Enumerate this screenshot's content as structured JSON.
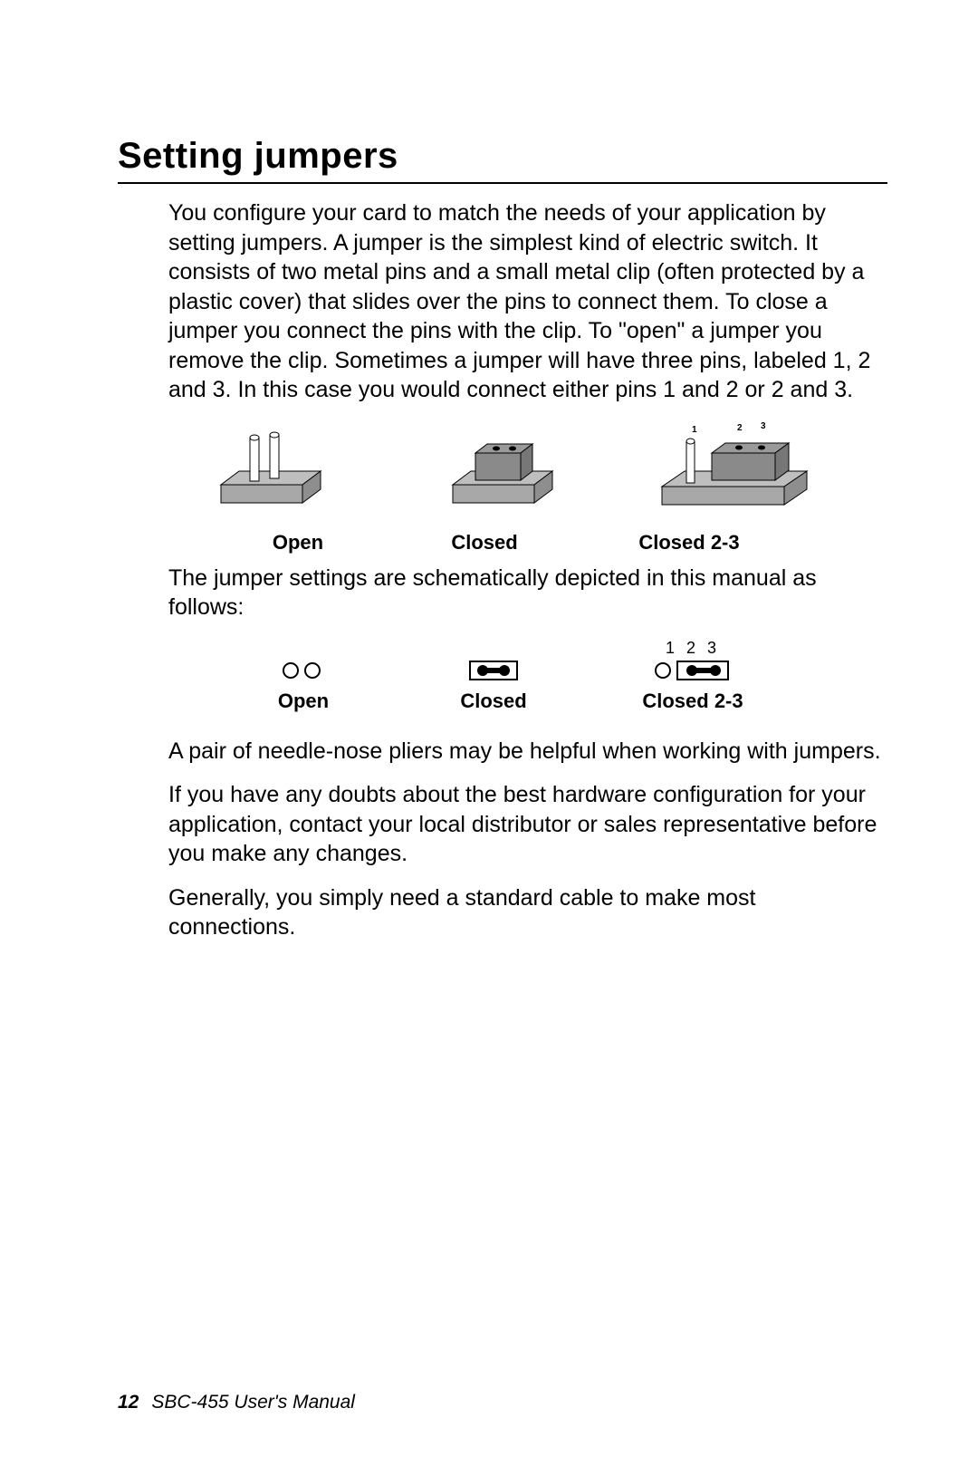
{
  "title": "Setting jumpers",
  "para1": "You configure your card to match the needs of your application by setting jumpers. A jumper is the simplest kind of electric switch. It consists of two metal pins and a small metal clip (often protected by a plastic cover) that slides over the pins to connect them. To close a jumper you connect the pins with the clip. To  \"open\" a jumper you remove the clip. Sometimes a jumper will have three pins, labeled 1, 2 and 3. In this case you would connect either pins 1 and 2 or 2 and 3.",
  "fig3d": {
    "open": "Open",
    "closed": "Closed",
    "closed23": "Closed 2-3"
  },
  "fig3d_pins": {
    "p1": "1",
    "p2": "2",
    "p3": "3"
  },
  "para2": "The jumper settings are schematically depicted in this manual as follows:",
  "schem": {
    "labels": {
      "open": "Open",
      "closed": "Closed",
      "closed23": "Closed 2-3"
    },
    "pins": "1 2 3"
  },
  "para3": "A pair of needle-nose pliers may be helpful when working with jumpers.",
  "para4": "If you have any doubts about the best hardware configuration for your application, contact your local distributor or sales representative before you make any changes.",
  "para5": "Generally, you simply need a standard cable to make most connections.",
  "footer": {
    "page": "12",
    "book": "SBC-455 User's Manual"
  }
}
